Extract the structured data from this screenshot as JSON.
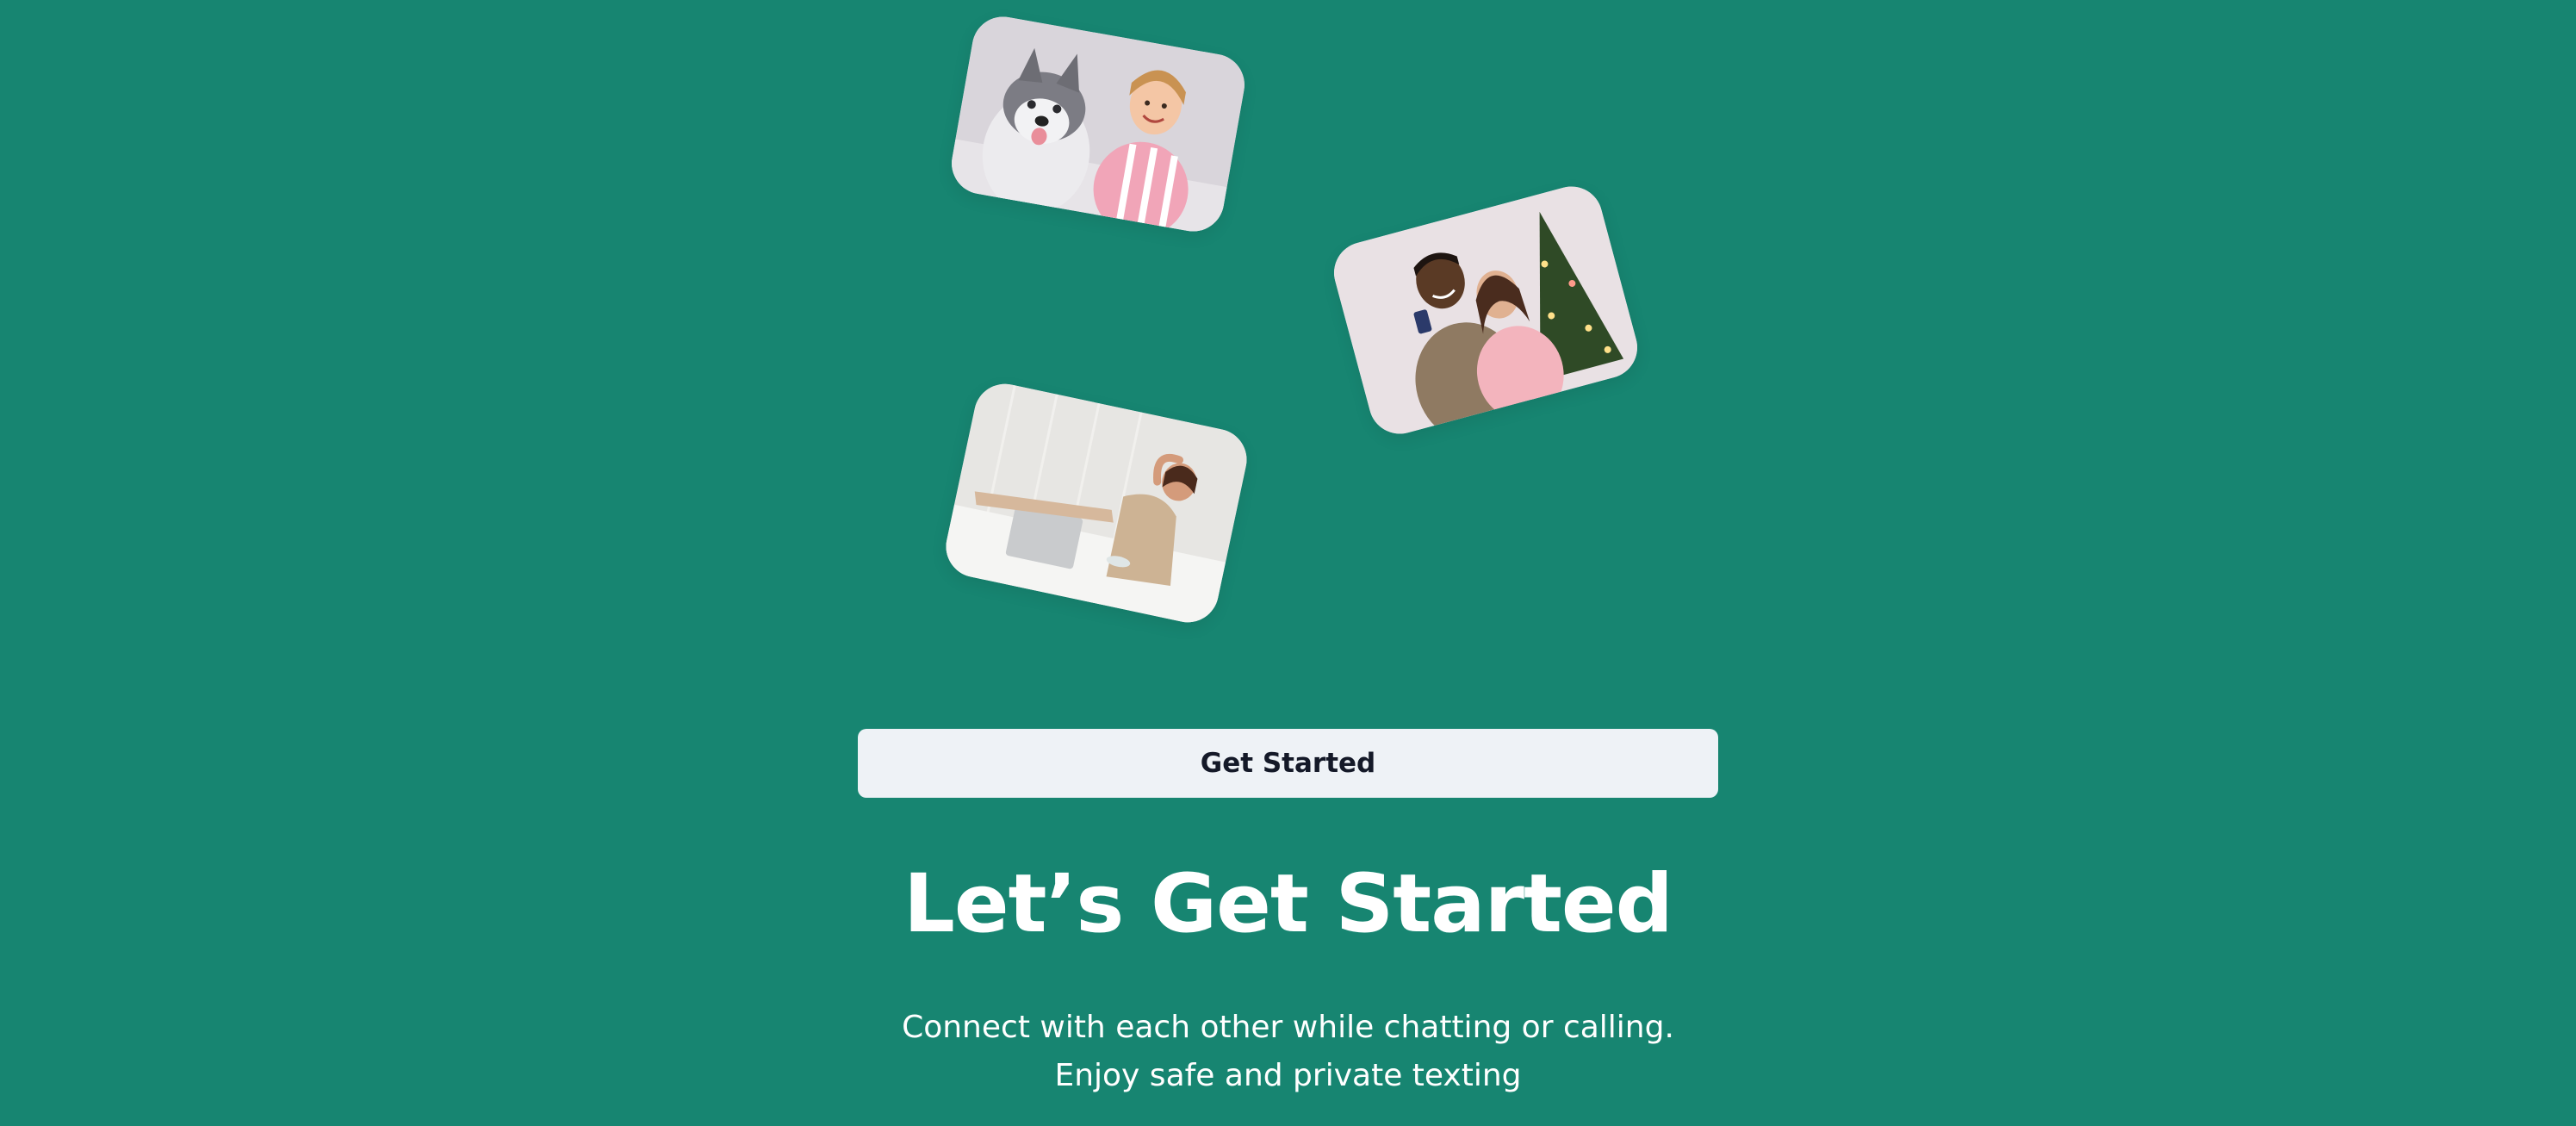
{
  "colors": {
    "background": "#178571",
    "button_background": "#eef2f6",
    "button_text": "#141928",
    "text": "#ffffff"
  },
  "images": [
    {
      "name": "dog-and-girl-photo",
      "icon": "photo"
    },
    {
      "name": "couple-christmas-tree-photo",
      "icon": "photo"
    },
    {
      "name": "woman-relaxing-photo",
      "icon": "photo"
    }
  ],
  "cta": {
    "label": "Get Started"
  },
  "headline": "Let’s Get Started",
  "subtitle": {
    "line1": "Connect with each other while chatting or calling.",
    "line2": "Enjoy safe and private texting"
  }
}
